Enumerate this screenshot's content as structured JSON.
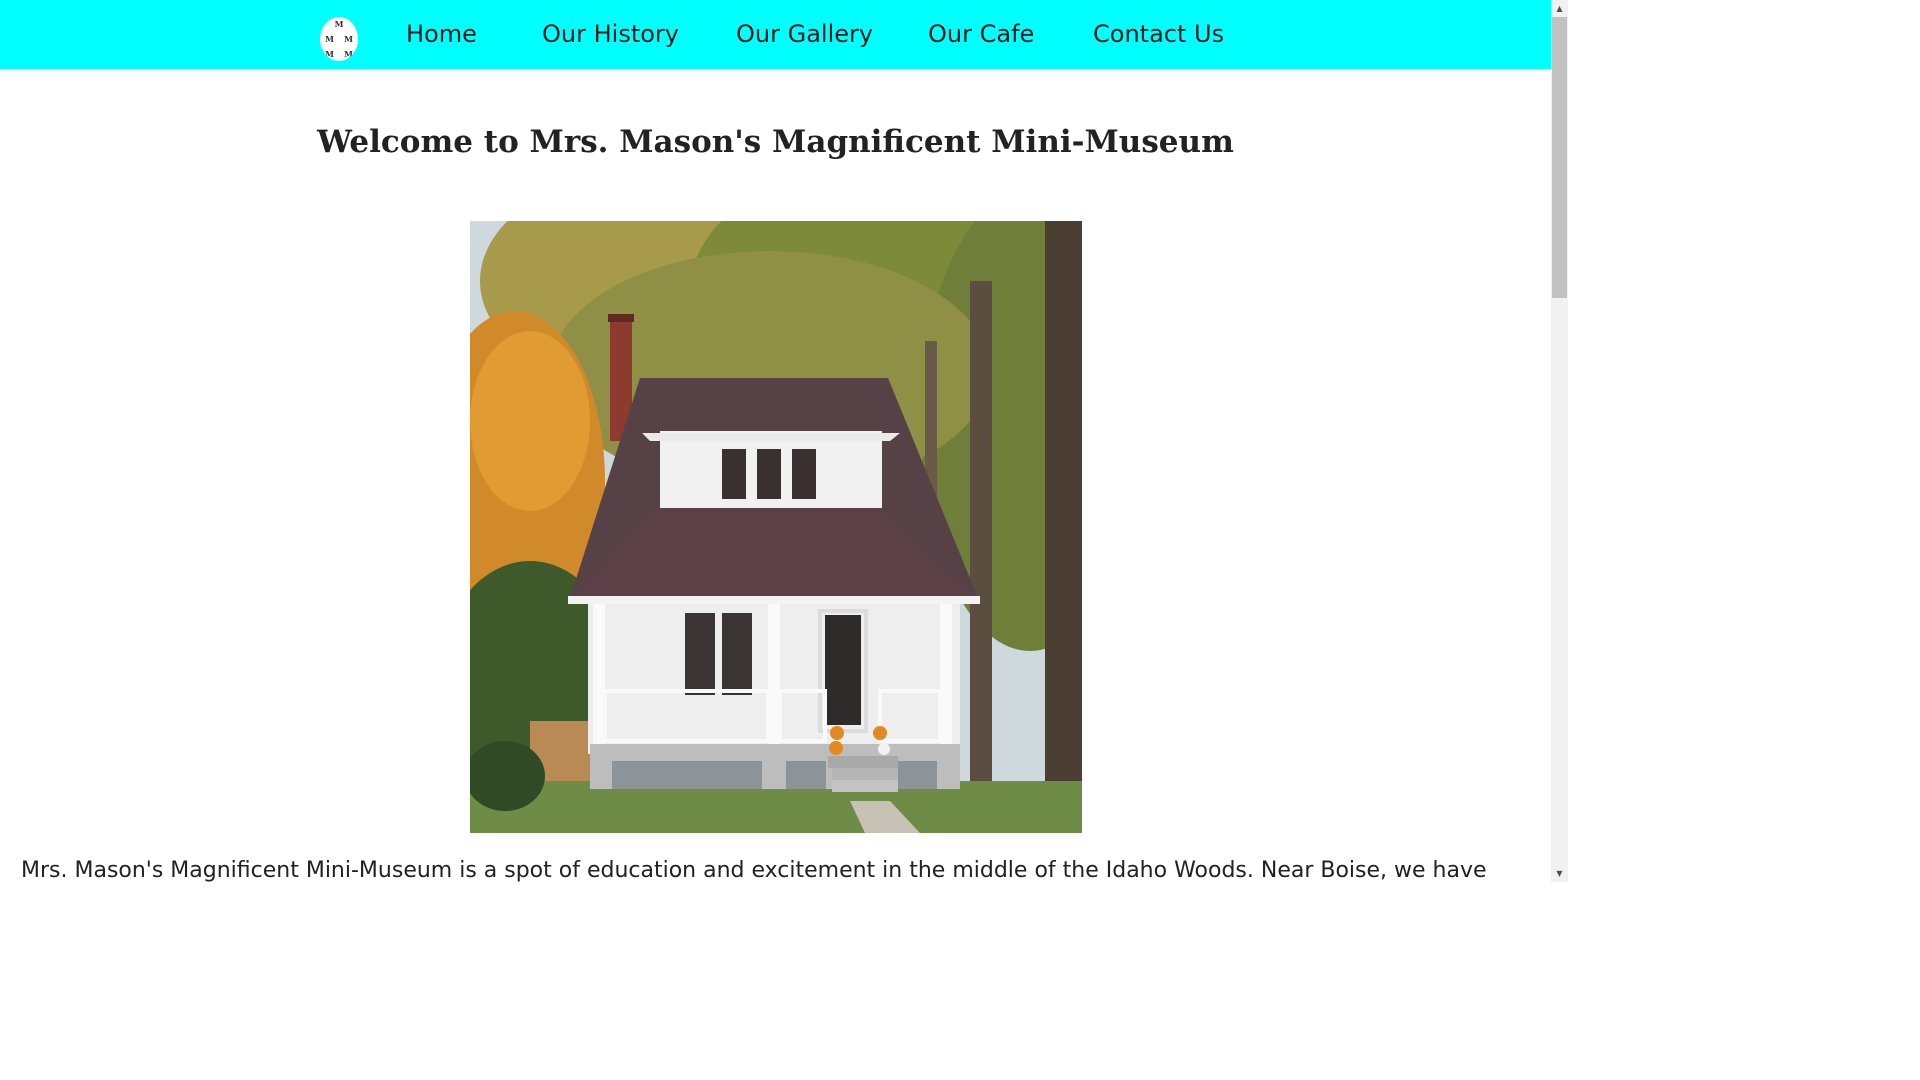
{
  "nav": {
    "logo_letters": [
      "M",
      "M",
      "M",
      "M",
      "M"
    ],
    "items": [
      {
        "label": "Home"
      },
      {
        "label": "Our History"
      },
      {
        "label": "Our Gallery"
      },
      {
        "label": "Our Cafe"
      },
      {
        "label": "Contact Us"
      }
    ],
    "background_color": "#00ffff"
  },
  "main": {
    "title": "Welcome to Mrs. Mason's Magnificent Mini-Museum",
    "intro": "Mrs. Mason's Magnificent Mini-Museum is a spot of education and excitement in the middle of the Idaho Woods. Near Boise, we have"
  },
  "scrollbar": {
    "up_icon": "▲",
    "down_icon": "▼"
  }
}
